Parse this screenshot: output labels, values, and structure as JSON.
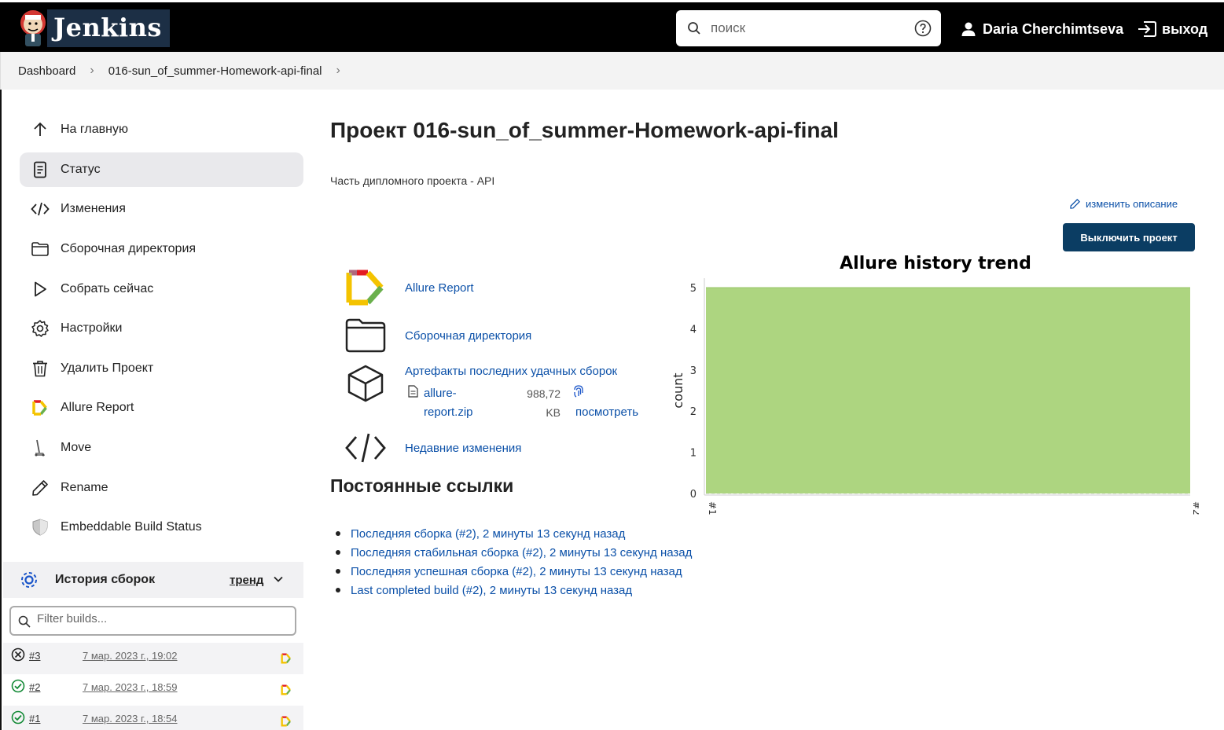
{
  "header": {
    "brand": "Jenkins",
    "search_placeholder": "поиск",
    "user_name": "Daria Cherchimtseva",
    "logout_label": "выход"
  },
  "breadcrumbs": [
    "Dashboard",
    "016-sun_of_summer-Homework-api-final"
  ],
  "sidebar": {
    "items": [
      {
        "label": "На главную",
        "icon": "arrow-up-icon"
      },
      {
        "label": "Статус",
        "icon": "document-icon",
        "active": true
      },
      {
        "label": "Изменения",
        "icon": "code-icon"
      },
      {
        "label": "Сборочная директория",
        "icon": "folder-icon"
      },
      {
        "label": "Собрать сейчас",
        "icon": "play-icon"
      },
      {
        "label": "Настройки",
        "icon": "gear-icon"
      },
      {
        "label": "Удалить Проект",
        "icon": "trash-icon"
      },
      {
        "label": "Allure Report",
        "icon": "allure-icon"
      },
      {
        "label": "Move",
        "icon": "move-icon"
      },
      {
        "label": "Rename",
        "icon": "pencil-icon"
      },
      {
        "label": "Embeddable Build Status",
        "icon": "shield-icon"
      }
    ]
  },
  "history": {
    "title": "История сборок",
    "trend_label": "тренд",
    "filter_placeholder": "Filter builds...",
    "builds": [
      {
        "number": "#3",
        "date": "7 мар. 2023 г., 19:02",
        "status": "aborted"
      },
      {
        "number": "#2",
        "date": "7 мар. 2023 г., 18:59",
        "status": "success"
      },
      {
        "number": "#1",
        "date": "7 мар. 2023 г., 18:54",
        "status": "success"
      }
    ]
  },
  "main": {
    "title": "Проект 016-sun_of_summer-Homework-api-final",
    "description": "Часть дипломного проекта - API",
    "edit_description": "изменить описание",
    "disable_button": "Выключить проект",
    "links": {
      "allure": "Allure Report",
      "workspace": "Сборочная директория",
      "artifacts": "Артефакты последних удачных сборок",
      "recent_changes": "Недавние изменения"
    },
    "artifact": {
      "file_name": "allure-report.zip",
      "file_size": "988,72 KB",
      "view_label": "посмотреть"
    },
    "permalinks_title": "Постоянные ссылки",
    "permalinks": [
      "Последняя сборка (#2), 2 минуты 13 секунд назад",
      "Последняя стабильная сборка (#2), 2 минуты 13 секунд назад",
      "Последняя успешная сборка (#2), 2 минуты 13 секунд назад",
      "Last completed build (#2), 2 минуты 13 секунд назад"
    ]
  },
  "colors": {
    "header_bg": "#000000",
    "brand_bg": "#1c2f45",
    "link": "#0b50a8",
    "button_bg": "#0b3d63",
    "chart_fill": "#add580",
    "success": "#138a36"
  },
  "chart_data": {
    "type": "area",
    "title": "Allure history trend",
    "ylabel": "count",
    "xlabel": "",
    "categories": [
      "#1",
      "#2"
    ],
    "series": [
      {
        "values": [
          5,
          5
        ]
      }
    ],
    "ylim": [
      0,
      5
    ],
    "yticks": [
      0,
      1,
      2,
      3,
      4,
      5
    ],
    "grid": true
  }
}
